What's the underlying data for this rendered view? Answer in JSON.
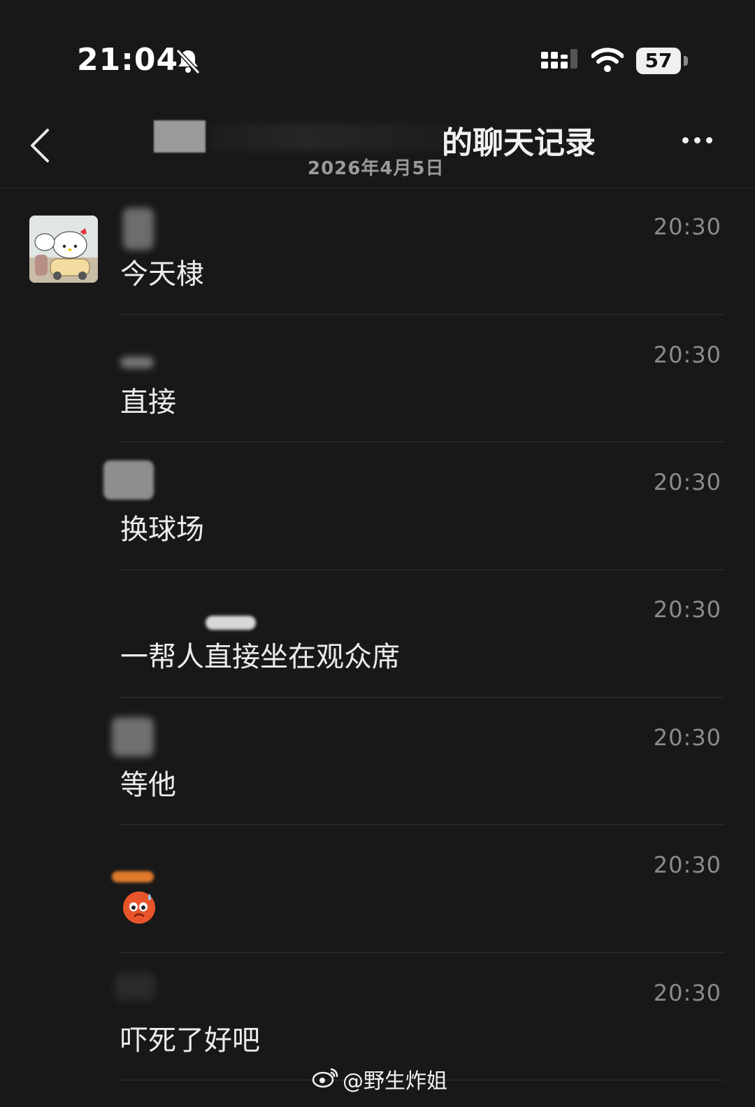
{
  "status_bar": {
    "time": "21:04",
    "battery": "57"
  },
  "header": {
    "back_icon": "chevron-left-icon",
    "title": "的聊天记录",
    "subtitle": "2026年4月5日",
    "more_icon": "ellipsis-icon"
  },
  "messages": [
    {
      "text": "今天棣",
      "time": "20:30"
    },
    {
      "text": "直接",
      "time": "20:30"
    },
    {
      "text": "换球场",
      "time": "20:30"
    },
    {
      "text": "一帮人直接坐在观众席",
      "time": "20:30"
    },
    {
      "text": "等他",
      "time": "20:30"
    },
    {
      "text": "",
      "time": "20:30",
      "emoji": "worried-face-icon"
    },
    {
      "text": "吓死了好吧",
      "time": "20:30"
    }
  ],
  "watermark": "@野生炸姐",
  "colors": {
    "background": "#181818",
    "text": "#ececec",
    "time": "#8c8c8c",
    "emoji": "#e8552a"
  }
}
